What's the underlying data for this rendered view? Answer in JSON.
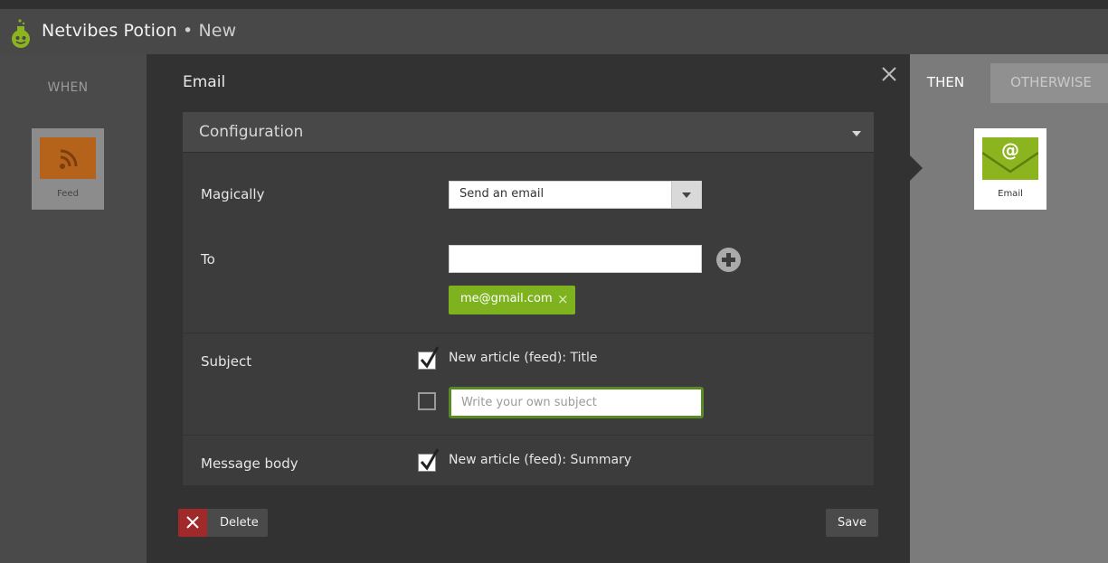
{
  "app": {
    "name": "Netvibes Potion",
    "separator": "•",
    "subtitle": "New"
  },
  "left": {
    "when_label": "WHEN",
    "trigger": {
      "label": "Feed",
      "icon": "rss-icon"
    }
  },
  "modal": {
    "title": "Email",
    "close_icon": "close-icon",
    "section": {
      "label": "Configuration"
    },
    "magically": {
      "label": "Magically",
      "selected": "Send an email"
    },
    "to": {
      "label": "To",
      "value": "",
      "tag": "me@gmail.com",
      "tag_remove": "×"
    },
    "subject": {
      "label": "Subject",
      "option_checked": "New article (feed): Title",
      "placeholder": "Write your own subject"
    },
    "message": {
      "label": "Message body",
      "option_checked": "New article (feed): Summary"
    },
    "footer": {
      "delete_label": "Delete",
      "save_label": "Save"
    }
  },
  "right": {
    "tab_then": "THEN",
    "tab_otherwise": "OTHERWISE",
    "action": {
      "label": "Email",
      "icon": "email-envelope-icon"
    }
  },
  "colors": {
    "accent": "#7fb21f",
    "danger": "#a02a2a",
    "focus": "#5a8a24"
  }
}
